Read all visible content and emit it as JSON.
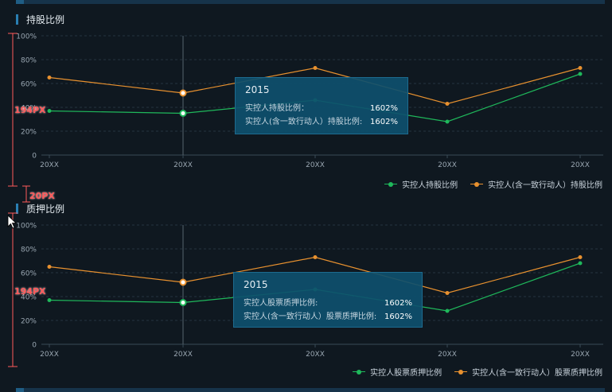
{
  "colors": {
    "series1": "#1fb85b",
    "series2": "#e8912f",
    "annotation": "#ff5a5a"
  },
  "annotations": {
    "chart_height": "194PX",
    "gap": "20PX"
  },
  "charts": [
    {
      "title": "持股比例",
      "tooltip": {
        "year": "2015",
        "rows": [
          {
            "label": "实控人持股比例：",
            "value": "1602%"
          },
          {
            "label": "实控人(含一致行动人）持股比例:",
            "value": "1602%"
          }
        ]
      },
      "legend": [
        "实控人持股比例",
        "实控人(含一致行动人）持股比例"
      ]
    },
    {
      "title": "质押比例",
      "tooltip": {
        "year": "2015",
        "rows": [
          {
            "label": "实控人股票质押比例:",
            "value": "1602%"
          },
          {
            "label": "实控人(含一致行动人）股票质押比例:",
            "value": "1602%"
          }
        ]
      },
      "legend": [
        "实控人股票质押比例",
        "实控人(含一致行动人）股票质押比例"
      ]
    }
  ],
  "chart_data": [
    {
      "type": "line",
      "title": "持股比例",
      "categories": [
        "20XX",
        "20XX",
        "20XX",
        "20XX",
        "20XX"
      ],
      "y_ticks": [
        "0",
        "20%",
        "40%",
        "60%",
        "80%",
        "100%"
      ],
      "ylim": [
        0,
        100
      ],
      "grid": true,
      "legend_position": "bottom-right",
      "series": [
        {
          "name": "实控人持股比例",
          "values": [
            37,
            35,
            46,
            28,
            68
          ]
        },
        {
          "name": "实控人(含一致行动人）持股比例",
          "values": [
            65,
            52,
            73,
            43,
            73
          ]
        }
      ]
    },
    {
      "type": "line",
      "title": "质押比例",
      "categories": [
        "20XX",
        "20XX",
        "20XX",
        "20XX",
        "20XX"
      ],
      "y_ticks": [
        "0",
        "20%",
        "40%",
        "60%",
        "80%",
        "100%"
      ],
      "ylim": [
        0,
        100
      ],
      "grid": true,
      "legend_position": "bottom-right",
      "series": [
        {
          "name": "实控人股票质押比例",
          "values": [
            37,
            35,
            46,
            28,
            68
          ]
        },
        {
          "name": "实控人(含一致行动人）股票质押比例",
          "values": [
            65,
            52,
            73,
            43,
            73
          ]
        }
      ]
    }
  ]
}
